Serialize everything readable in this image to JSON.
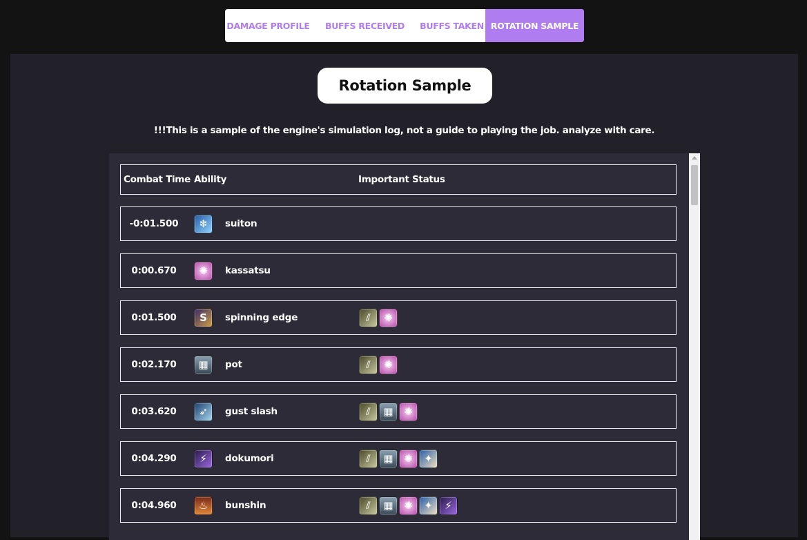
{
  "tabs": [
    {
      "label": "DAMAGE PROFILE",
      "active": false
    },
    {
      "label": "BUFFS RECEIVED",
      "active": false
    },
    {
      "label": "BUFFS TAKEN",
      "active": false
    },
    {
      "label": "ROTATION SAMPLE",
      "active": true
    }
  ],
  "title": "Rotation Sample",
  "notice": "!!!This is a sample of the engine's simulation log, not a guide to playing the job. analyze with care.",
  "table": {
    "headers": {
      "time": "Combat Time",
      "ability": "Ability",
      "status": "Important Status"
    },
    "rows": [
      {
        "time": "-0:01.500",
        "ability": "suiton",
        "ability_icon": "suiton-icon",
        "statuses": []
      },
      {
        "time": "0:00.670",
        "ability": "kassatsu",
        "ability_icon": "kassatsu-icon",
        "statuses": []
      },
      {
        "time": "0:01.500",
        "ability": "spinning edge",
        "ability_icon": "spinning-edge-icon",
        "statuses": [
          "blade-buff-icon",
          "kassatsu-icon"
        ]
      },
      {
        "time": "0:02.170",
        "ability": "pot",
        "ability_icon": "pot-icon",
        "statuses": [
          "blade-buff-icon",
          "kassatsu-icon"
        ]
      },
      {
        "time": "0:03.620",
        "ability": "gust slash",
        "ability_icon": "gust-slash-icon",
        "statuses": [
          "blade-buff-icon",
          "pot-icon",
          "kassatsu-icon"
        ]
      },
      {
        "time": "0:04.290",
        "ability": "dokumori",
        "ability_icon": "dokumori-icon",
        "statuses": [
          "blade-buff-icon",
          "pot-icon",
          "kassatsu-icon",
          "suiton-buff-icon"
        ]
      },
      {
        "time": "0:04.960",
        "ability": "bunshin",
        "ability_icon": "bunshin-icon",
        "statuses": [
          "blade-buff-icon",
          "pot-icon",
          "kassatsu-icon",
          "suiton-buff-icon",
          "dokumori-icon"
        ]
      }
    ]
  },
  "icon_styles": {
    "suiton-icon": {
      "bg": "linear-gradient(135deg,#2a5fa8,#8fd3ff)",
      "glyph": "❄"
    },
    "kassatsu-icon": {
      "bg": "radial-gradient(circle,#f6c8f0,#b44ca8)",
      "glyph": "✺"
    },
    "spinning-edge-icon": {
      "bg": "linear-gradient(135deg,#3a2a6a,#d0a040)",
      "glyph": "S"
    },
    "pot-icon": {
      "bg": "linear-gradient(180deg,#8aa0b0,#3a4a58)",
      "glyph": "▦"
    },
    "gust-slash-icon": {
      "bg": "linear-gradient(135deg,#1d3f6e,#a8d8f0)",
      "glyph": "➶"
    },
    "dokumori-icon": {
      "bg": "linear-gradient(135deg,#2a1a4a,#9a6ae0)",
      "glyph": "⚡"
    },
    "bunshin-icon": {
      "bg": "linear-gradient(180deg,#7a2a1a,#e08a3a)",
      "glyph": "♨"
    },
    "blade-buff-icon": {
      "bg": "linear-gradient(135deg,#4a4a2a,#c8c8a0)",
      "glyph": "⫽"
    },
    "suiton-buff-icon": {
      "bg": "linear-gradient(135deg,#2a5fa8,#f0e0c0)",
      "glyph": "✦"
    }
  },
  "colors": {
    "accent": "#b07df0",
    "background": "#131313",
    "panel": "#222029",
    "table": "#2d2b38"
  }
}
